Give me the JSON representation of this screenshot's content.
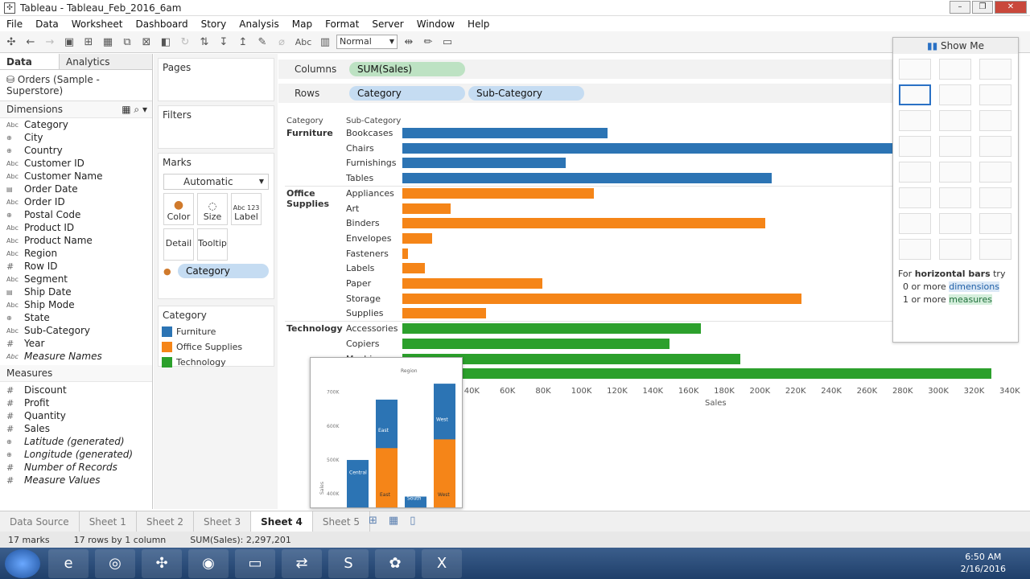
{
  "window": {
    "title": "Tableau - Tableau_Feb_2016_6am"
  },
  "menu": [
    "File",
    "Data",
    "Worksheet",
    "Dashboard",
    "Story",
    "Analysis",
    "Map",
    "Format",
    "Server",
    "Window",
    "Help"
  ],
  "toolbar": {
    "fit": "Normal",
    "abc": "Abc"
  },
  "data_pane": {
    "tabs": {
      "data": "Data",
      "analytics": "Analytics"
    },
    "source": "Orders (Sample - Superstore)",
    "dimensions_label": "Dimensions",
    "dimensions": [
      {
        "icon": "Abc",
        "name": "Category"
      },
      {
        "icon": "globe",
        "name": "City"
      },
      {
        "icon": "globe",
        "name": "Country"
      },
      {
        "icon": "Abc",
        "name": "Customer ID"
      },
      {
        "icon": "Abc",
        "name": "Customer Name"
      },
      {
        "icon": "date",
        "name": "Order Date"
      },
      {
        "icon": "Abc",
        "name": "Order ID"
      },
      {
        "icon": "globe",
        "name": "Postal Code"
      },
      {
        "icon": "Abc",
        "name": "Product ID"
      },
      {
        "icon": "Abc",
        "name": "Product Name"
      },
      {
        "icon": "Abc",
        "name": "Region"
      },
      {
        "icon": "#",
        "name": "Row ID"
      },
      {
        "icon": "Abc",
        "name": "Segment"
      },
      {
        "icon": "date",
        "name": "Ship Date"
      },
      {
        "icon": "Abc",
        "name": "Ship Mode"
      },
      {
        "icon": "globe",
        "name": "State"
      },
      {
        "icon": "Abc",
        "name": "Sub-Category"
      },
      {
        "icon": "#",
        "name": "Year"
      },
      {
        "icon": "Abc",
        "name": "Measure Names",
        "italic": true
      }
    ],
    "measures_label": "Measures",
    "measures": [
      {
        "icon": "#",
        "name": "Discount"
      },
      {
        "icon": "#",
        "name": "Profit"
      },
      {
        "icon": "#",
        "name": "Quantity"
      },
      {
        "icon": "#",
        "name": "Sales"
      },
      {
        "icon": "globe",
        "name": "Latitude (generated)",
        "italic": true
      },
      {
        "icon": "globe",
        "name": "Longitude (generated)",
        "italic": true
      },
      {
        "icon": "#",
        "name": "Number of Records",
        "italic": true
      },
      {
        "icon": "#",
        "name": "Measure Values",
        "italic": true
      }
    ]
  },
  "cards": {
    "pages": "Pages",
    "filters": "Filters",
    "marks": "Marks",
    "mark_type": "Automatic",
    "color": "Color",
    "size": "Size",
    "label": "Label",
    "detail": "Detail",
    "tooltip": "Tooltip",
    "color_pill": "Category"
  },
  "legend": {
    "title": "Category",
    "items": [
      {
        "name": "Furniture",
        "color": "#2c74b4"
      },
      {
        "name": "Office Supplies",
        "color": "#f58518"
      },
      {
        "name": "Technology",
        "color": "#2ca02c"
      }
    ]
  },
  "shelves": {
    "columns_label": "Columns",
    "columns_pill": "SUM(Sales)",
    "rows_label": "Rows",
    "rows_pills": [
      "Category",
      "Sub-Category"
    ]
  },
  "chart_data": {
    "type": "bar",
    "orientation": "horizontal",
    "col_headers": [
      "Category",
      "Sub-Category"
    ],
    "xlabel": "Sales",
    "xlim": [
      0,
      340000
    ],
    "ticks": [
      "40K",
      "60K",
      "80K",
      "100K",
      "120K",
      "140K",
      "160K",
      "180K",
      "200K",
      "220K",
      "240K",
      "260K",
      "280K",
      "300K",
      "320K",
      "340K"
    ],
    "groups": [
      {
        "category": "Furniture",
        "color": "#2c74b4",
        "rows": [
          {
            "sub": "Bookcases",
            "value": 114880
          },
          {
            "sub": "Chairs",
            "value": 328449
          },
          {
            "sub": "Furnishings",
            "value": 91705
          },
          {
            "sub": "Tables",
            "value": 206966
          }
        ]
      },
      {
        "category": "Office Supplies",
        "color": "#f58518",
        "rows": [
          {
            "sub": "Appliances",
            "value": 107532
          },
          {
            "sub": "Art",
            "value": 27119
          },
          {
            "sub": "Binders",
            "value": 203413
          },
          {
            "sub": "Envelopes",
            "value": 16476
          },
          {
            "sub": "Fasteners",
            "value": 3024
          },
          {
            "sub": "Labels",
            "value": 12486
          },
          {
            "sub": "Paper",
            "value": 78479
          },
          {
            "sub": "Storage",
            "value": 223844
          },
          {
            "sub": "Supplies",
            "value": 46674
          }
        ]
      },
      {
        "category": "Technology",
        "color": "#2ca02c",
        "rows": [
          {
            "sub": "Accessories",
            "value": 167380
          },
          {
            "sub": "Copiers",
            "value": 149528
          },
          {
            "sub": "Machines",
            "value": 189239
          },
          {
            "sub": "Phones",
            "value": 330007
          }
        ]
      }
    ]
  },
  "show_me": {
    "title": "Show Me",
    "hint_prefix": "For ",
    "hint_bold": "horizontal bars",
    "hint_suffix": " try",
    "req1_prefix": "0 or more ",
    "req1": "dimensions",
    "req2_prefix": "1 or more ",
    "req2": "measures"
  },
  "popup": {
    "title": "Region",
    "yticks": [
      "700K",
      "600K",
      "500K",
      "400K"
    ],
    "ylabel": "Sales",
    "bars": [
      {
        "name": "Central",
        "top": 500,
        "bottom_label": ""
      },
      {
        "name": "East",
        "top": 678,
        "bottom_label": "East"
      },
      {
        "name": "South",
        "top": 392,
        "bottom_label": ""
      },
      {
        "name": "West",
        "top": 725,
        "bottom_label": "West"
      }
    ]
  },
  "sheets": [
    "Data Source",
    "Sheet 1",
    "Sheet 2",
    "Sheet 3",
    "Sheet 4",
    "Sheet 5"
  ],
  "active_sheet": "Sheet 4",
  "status": {
    "marks": "17 marks",
    "dims": "17 rows by 1 column",
    "sum": "SUM(Sales): 2,297,201"
  },
  "clock": {
    "time": "6:50 AM",
    "date": "2/16/2016"
  }
}
